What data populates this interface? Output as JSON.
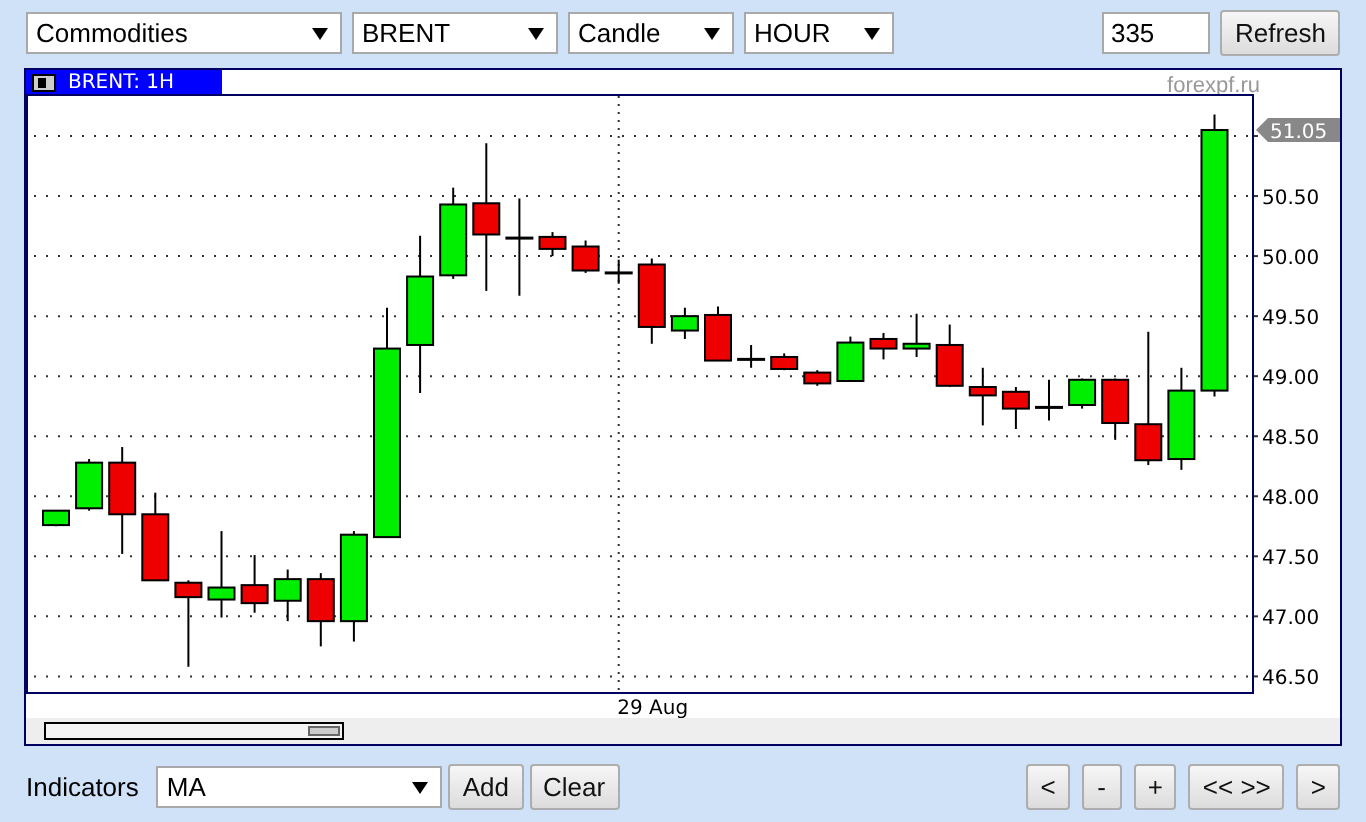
{
  "toolbar": {
    "selects": [
      {
        "value": "Commodities"
      },
      {
        "value": "BRENT"
      },
      {
        "value": "Candle"
      },
      {
        "value": "HOUR"
      }
    ],
    "bars_field": {
      "value": "335"
    },
    "refresh_button": "Refresh"
  },
  "chart_panel": {
    "tab": "BRENT: 1H",
    "source": "forexpf.ru",
    "chart_data": {
      "type": "candlestick",
      "grid": true,
      "ylim": [
        46.37,
        51.35
      ],
      "yticks": [
        {
          "value": 46.5,
          "label": "46.50"
        },
        {
          "value": 47,
          "label": "47.00"
        },
        {
          "value": 47.5,
          "label": "47.50"
        },
        {
          "value": 48,
          "label": "48.00"
        },
        {
          "value": 48.5,
          "label": "48.50"
        },
        {
          "value": 49,
          "label": "49.00"
        },
        {
          "value": 49.5,
          "label": "49.50"
        },
        {
          "value": 50,
          "label": "50.00"
        },
        {
          "value": 50.5,
          "label": "50.50"
        }
      ],
      "ohlc": [
        [
          47.76,
          47.88,
          47.75,
          47.88
        ],
        [
          47.9,
          48.31,
          47.88,
          48.28
        ],
        [
          48.28,
          48.41,
          47.52,
          47.85
        ],
        [
          47.85,
          48.03,
          47.3,
          47.3
        ],
        [
          47.28,
          47.3,
          46.58,
          47.16
        ],
        [
          47.14,
          47.71,
          46.99,
          47.24
        ],
        [
          47.26,
          47.51,
          47.03,
          47.11
        ],
        [
          47.13,
          47.39,
          46.96,
          47.31
        ],
        [
          47.31,
          47.36,
          46.75,
          46.96
        ],
        [
          46.96,
          47.71,
          46.79,
          47.68
        ],
        [
          47.66,
          49.57,
          47.66,
          49.23
        ],
        [
          49.26,
          50.17,
          48.86,
          49.83
        ],
        [
          49.84,
          50.57,
          49.81,
          50.43
        ],
        [
          50.44,
          50.94,
          49.71,
          50.18
        ],
        [
          50.15,
          50.48,
          49.67,
          50.15
        ],
        [
          50.16,
          50.2,
          50.0,
          50.06
        ],
        [
          50.08,
          50.13,
          49.86,
          49.88
        ],
        [
          49.86,
          49.97,
          49.77,
          49.86
        ],
        [
          49.93,
          49.98,
          49.27,
          49.41
        ],
        [
          49.38,
          49.57,
          49.31,
          49.5
        ],
        [
          49.51,
          49.58,
          49.13,
          49.13
        ],
        [
          49.14,
          49.26,
          49.07,
          49.14
        ],
        [
          49.16,
          49.19,
          49.05,
          49.06
        ],
        [
          49.03,
          49.05,
          48.92,
          48.94
        ],
        [
          48.96,
          49.33,
          48.96,
          49.28
        ],
        [
          49.31,
          49.36,
          49.14,
          49.23
        ],
        [
          49.23,
          49.52,
          49.16,
          49.27
        ],
        [
          49.26,
          49.43,
          48.91,
          48.92
        ],
        [
          48.91,
          49.07,
          48.59,
          48.84
        ],
        [
          48.87,
          48.91,
          48.56,
          48.73
        ],
        [
          48.74,
          48.97,
          48.63,
          48.74
        ],
        [
          48.76,
          48.98,
          48.73,
          48.97
        ],
        [
          48.97,
          48.98,
          48.47,
          48.61
        ],
        [
          48.6,
          49.37,
          48.26,
          48.3
        ],
        [
          48.31,
          49.07,
          48.22,
          48.88
        ],
        [
          48.88,
          51.18,
          48.83,
          51.05
        ]
      ],
      "annotations": [
        "29 Aug",
        "51.05"
      ]
    }
  },
  "bottom_bar": {
    "indicators_label": "Indicators",
    "indicator_select": {
      "value": "MA"
    },
    "buttons": [
      "Add",
      "Clear"
    ],
    "nav_buttons": [
      "<",
      "-",
      "+",
      "<< >>",
      ">"
    ]
  }
}
